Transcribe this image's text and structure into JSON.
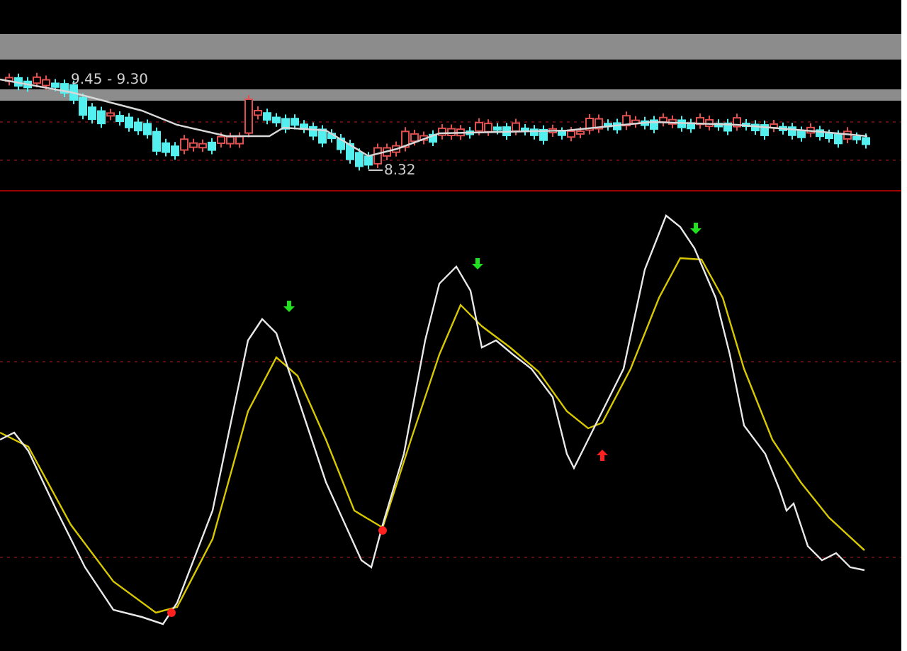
{
  "price_panel": {
    "range_label": "9.45 - 9.30",
    "low_label": "8.32"
  }
}
